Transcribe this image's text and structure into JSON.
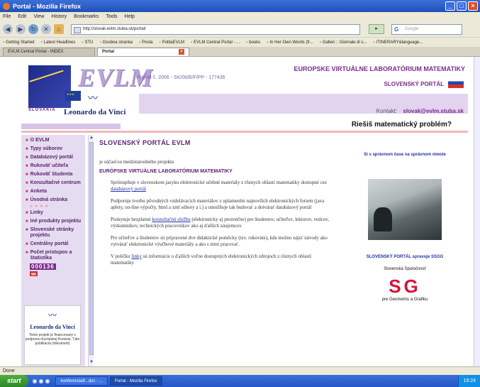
{
  "window": {
    "title": "Portal - Mozilla Firefox",
    "min": "_",
    "max": "□",
    "close": "×"
  },
  "menu": [
    "File",
    "Edit",
    "View",
    "History",
    "Bookmarks",
    "Tools",
    "Help"
  ],
  "nav": {
    "url": "http://slovak.evlm.stuba.sk/portal/",
    "search_placeholder": "Google",
    "go": "▸"
  },
  "bookmarks": [
    "Getting Started",
    "Latest Headlines",
    "STU",
    "Osobna stranka",
    "Posta",
    "PolitaEVLM",
    "EVLM Central Portal - ...",
    "books",
    "In Her Own Words (fr...",
    "Gallen :: Giornale di s...",
    "ITINERARY&language..."
  ],
  "tabs": [
    {
      "label": "EVLM Central Portal - INDEX"
    },
    {
      "label": "Portal"
    }
  ],
  "header": {
    "logo": "EVLM",
    "project": "Projekt č. 2006 - SK/06/B/F/PP - 177436",
    "country": "SLOVAKIA",
    "leonardo": "Leonardo da Vinci",
    "title": "EUROPSKE VIRTUÁLNE LABORATÓRIUM MATEMATIKY",
    "portal": "SLOVENSKÝ PORTÁL",
    "contact_label": "Kontakt:",
    "contact_email": "slovak@evlm.stuba.sk",
    "slogan": "Riešiš matematický problém?"
  },
  "sidebar": {
    "items": [
      {
        "label": "O EVLM"
      },
      {
        "label": "Typy súborov"
      },
      {
        "label": "Databázový portál"
      },
      {
        "label": "Rukoväť učiteľa"
      },
      {
        "label": "Rukoväť študenta"
      },
      {
        "label": "Konzultačné centrum"
      },
      {
        "label": "Anketa"
      },
      {
        "label": "Úvodná stránka"
      },
      {
        "label": "Linky"
      },
      {
        "label": "Iné produkty projektu"
      },
      {
        "label": "Slovenské stránky projektu"
      },
      {
        "label": "Centrálny portál"
      },
      {
        "label": "Počet prístupov a štatistika"
      }
    ],
    "counter": "000136",
    "leonardo_box": {
      "name": "Leonardo da Vinci",
      "text": "Tento projekt je financovaný s podporou Európskej Komisie. Táto publikácia (dokument)"
    }
  },
  "main": {
    "title": "SLOVENSKÝ PORTÁL EVLM",
    "intro": "je súčasťou medzinárodného projektu",
    "subtitle": "EURÓPSKE VIRTUÁLNE LABORATÓRIUM MATEMATIKY",
    "p1_text": "Sprístupňuje v slovenskom jazyku elektronické učebné materiály z rôznych oblastí matematiky dostupné cez ",
    "p1_link": "databázový portál",
    "p2": "Podporuje tvorbu pôvodných vzdelávacích materiálov z uplatnením najnovších elektronických foriem (java aplety, on-line výpočty, html a xml súbory a i.) a umožňuje tak budovať a dotvárať databázový portál",
    "p3_a": "Poskytuje bezplatnú ",
    "p3_link": "konzultačnú službu",
    "p3_b": " (elektronicky aj prezenčne) pre študentov, učiteľov, lektorov, vedcov, výskumníkov, technických pracovníkov ako aj ďalších záujemcov",
    "p4": "Pre učiteľov a študentov sú pripravené dve didaktické pomôcky (tzv. rukoväte), kde možno nájsť návody ako vytvárať elektronické výučbové materiály a ako s nimi pracovať.",
    "p5_a": "V políčku ",
    "p5_link": "linky",
    "p5_b": " sú informácie o ďalších voľne dostupných elektronických zdrojoch z rôznych oblastí matematiky"
  },
  "right": {
    "promo": "Si v správnom čase na správnom mieste",
    "ssgg": "SLOVENSKÝ PORTÁL spravuje SSGG",
    "spol": "Slovenská Spoločnosť",
    "sg": "SG",
    "geo": "pre Geometriu a Grafiku"
  },
  "status": "Done",
  "taskbar": {
    "start": "start",
    "tasks": [
      "konferencia9...doc - ...",
      "Portal - Mozilla Firefox"
    ],
    "clock": "19:24"
  },
  "colors": {
    "accent": "#7a2c8c",
    "sidebar_bg": "#e6dcf1",
    "sg_red": "#d5123a"
  }
}
